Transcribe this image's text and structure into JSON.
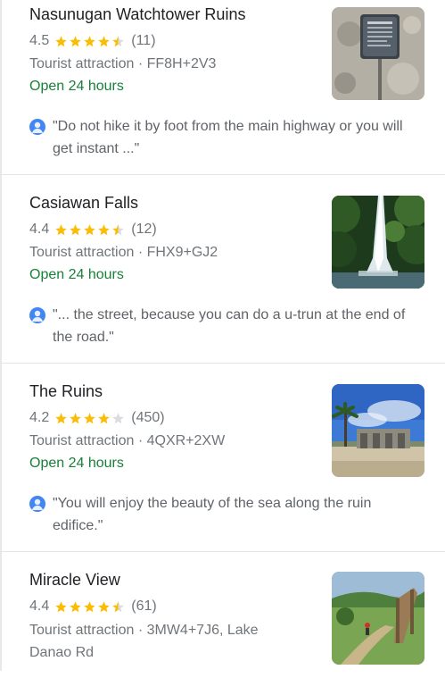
{
  "places": [
    {
      "name": "Nasunugan Watchtower Ruins",
      "rating": "4.5",
      "stars": 4.5,
      "reviews": "(11)",
      "type_address": "Tourist attraction · FF8H+2V3",
      "hours": "Open 24 hours",
      "review": "\"Do not hike it by foot from the main highway or you will get instant ...\"",
      "thumb_icon": "ruins-marker-photo"
    },
    {
      "name": "Casiawan Falls",
      "rating": "4.4",
      "stars": 4.5,
      "reviews": "(12)",
      "type_address": "Tourist attraction · FHX9+GJ2",
      "hours": "Open 24 hours",
      "review": "\"... the street, because you can do a u-trun at the end of the road.\"",
      "thumb_icon": "waterfall-photo"
    },
    {
      "name": "The Ruins",
      "rating": "4.2",
      "stars": 4,
      "reviews": "(450)",
      "type_address": "Tourist attraction · 4QXR+2XW",
      "hours": "Open 24 hours",
      "review": "\"You will enjoy the beauty of the sea along the ruin edifice.\"",
      "thumb_icon": "beach-ruins-photo"
    },
    {
      "name": "Miracle View",
      "rating": "4.4",
      "stars": 4.5,
      "reviews": "(61)",
      "type_address": "Tourist attraction · 3MW4+7J6, Lake Danao Rd",
      "thumb_icon": "hillside-view-photo"
    }
  ],
  "colors": {
    "star": "#fbbc04",
    "star_empty": "#dadce0",
    "open": "#188038",
    "avatar": "#4285f4"
  }
}
